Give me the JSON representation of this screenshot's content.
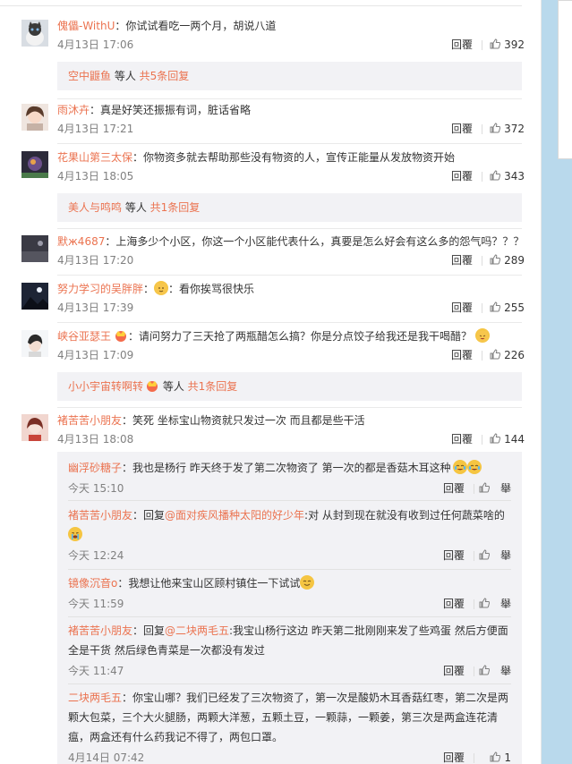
{
  "reply_label": "回覆",
  "report_label": "舉",
  "comments": [
    {
      "user": "傀儡-WithU",
      "text": "：你试试看吃一两个月，胡说八道",
      "time": "4月13日 17:06",
      "likes": "392"
    },
    {
      "user": "雨沐卉",
      "text": "：真是好笑还振振有词，脏话省略",
      "time": "4月13日 17:21",
      "likes": "372"
    },
    {
      "user": "花果山第三太保",
      "text": "：你物资多就去帮助那些没有物资的人，宣传正能量从发放物资开始",
      "time": "4月13日 18:05",
      "likes": "343"
    },
    {
      "user": "默ж4687",
      "text": "：上海多少个小区，你这一个小区能代表什么，真要是怎么好会有这么多的怨气吗？？？",
      "time": "4月13日 17:20",
      "likes": "289"
    },
    {
      "user": "努力学习的吴胖胖",
      "text": "：看你挨骂很快乐",
      "time": "4月13日 17:39",
      "likes": "255"
    },
    {
      "user": "峡谷亚瑟王",
      "text": "：请问努力了三天抢了两瓶醋怎么搞？你是分点饺子给我还是我干喝醋？",
      "time": "4月13日 17:09",
      "likes": "226"
    },
    {
      "user": "褚苦苦小朋友",
      "text": "：笑死 坐标宝山物资就只发过一次 而且都是些干活",
      "time": "4月13日 18:08",
      "likes": "144"
    }
  ],
  "more_replies": [
    {
      "user": "空中鼴鱼",
      "mid": " 等人 ",
      "count": "共5条回复"
    },
    {
      "user": "美人与鸣鸣",
      "mid": " 等人 ",
      "count": "共1条回复"
    },
    {
      "user": "小小宇宙转啊转",
      "mid": " 等人 ",
      "count": "共1条回复"
    }
  ],
  "sub_replies": [
    {
      "user": "幽浮砂糖子",
      "text": "：我也是杨行 昨天终于发了第二次物资了 第一次的都是香菇木耳这种",
      "time": "今天 15:10"
    },
    {
      "user": "褚苦苦小朋友",
      "pre": "：回复",
      "at": "@面对疾风播种太阳的好少年",
      "text": ":对 从封到现在就没有收到过任何蔬菜啥的",
      "time": "今天 12:24"
    },
    {
      "user": "镜像沉音o",
      "text": "：我想让他来宝山区顾村镇住一下试试",
      "time": "今天 11:59"
    },
    {
      "user": "褚苦苦小朋友",
      "pre": "：回复",
      "at": "@二块两毛五",
      "text": ":我宝山杨行这边 昨天第二批刚刚来发了些鸡蛋 然后方便面全是干货 然后绿色青菜是一次都没有发过",
      "time": "今天 11:47"
    },
    {
      "user": "二块两毛五",
      "text": "：你宝山哪？我们已经发了三次物资了，第一次是酸奶木耳香菇红枣，第二次是两颗大包菜，三个大火腿肠，两颗大洋葱，五颗土豆，一颗蒜，一颗姜，第三次是两盒连花清瘟，两盒还有什么药我记不得了，两包口罩。",
      "time": "4月14日 07:42",
      "likes": "1"
    }
  ]
}
